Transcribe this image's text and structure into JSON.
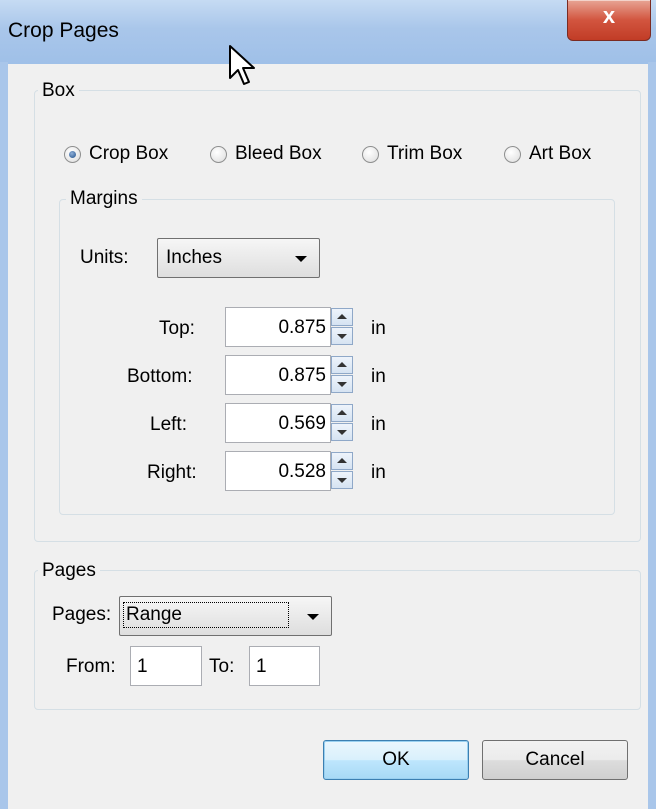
{
  "window": {
    "title": "Crop Pages",
    "close_symbol": "x"
  },
  "box_group": {
    "legend": "Box",
    "radios": [
      {
        "label": "Crop Box",
        "checked": true
      },
      {
        "label": "Bleed Box",
        "checked": false
      },
      {
        "label": "Trim Box",
        "checked": false
      },
      {
        "label": "Art Box",
        "checked": false
      }
    ]
  },
  "margins_group": {
    "legend": "Margins",
    "units_label": "Units:",
    "units_value": "Inches",
    "fields": [
      {
        "label": "Top:",
        "value": "0.875",
        "unit": "in"
      },
      {
        "label": "Bottom:",
        "value": "0.875",
        "unit": "in"
      },
      {
        "label": "Left:",
        "value": "0.569",
        "unit": "in"
      },
      {
        "label": "Right:",
        "value": "0.528",
        "unit": "in"
      }
    ]
  },
  "pages_group": {
    "legend": "Pages",
    "pages_label": "Pages:",
    "pages_value": "Range",
    "from_label": "From:",
    "from_value": "1",
    "to_label": "To:",
    "to_value": "1"
  },
  "buttons": {
    "ok": "OK",
    "cancel": "Cancel"
  }
}
